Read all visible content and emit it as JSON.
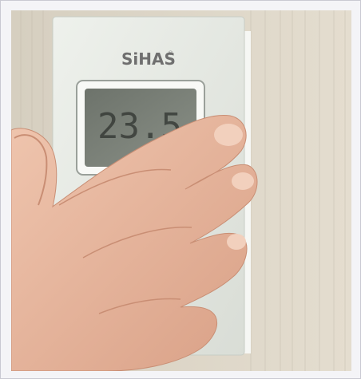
{
  "device": {
    "brand": "SiHAS",
    "registered_mark": "®",
    "display_value": "23.5"
  },
  "colors": {
    "wall": "#dcd5c6",
    "panel": "#e8ece6",
    "lcd": "#7b8079",
    "skin": "#e6b8a1"
  }
}
